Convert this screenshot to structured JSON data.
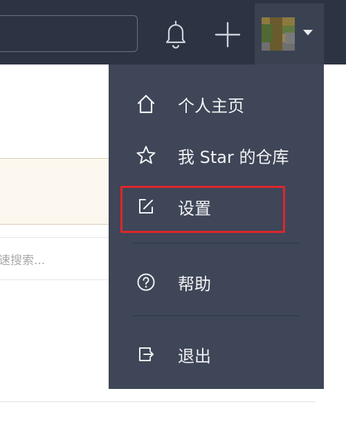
{
  "header": {
    "notifications_icon": "bell-icon",
    "new_icon": "plus-icon",
    "avatar_caret_icon": "caret-down-icon"
  },
  "page": {
    "filter_placeholder": "速搜索..."
  },
  "menu": {
    "items": [
      {
        "label": "个人主页",
        "icon": "home-icon"
      },
      {
        "label": "我 Star 的仓库",
        "icon": "star-icon"
      },
      {
        "label": "设置",
        "icon": "edit-icon"
      },
      {
        "label": "帮助",
        "icon": "help-icon"
      },
      {
        "label": "退出",
        "icon": "logout-icon"
      }
    ],
    "highlight_color": "#e0262c"
  }
}
